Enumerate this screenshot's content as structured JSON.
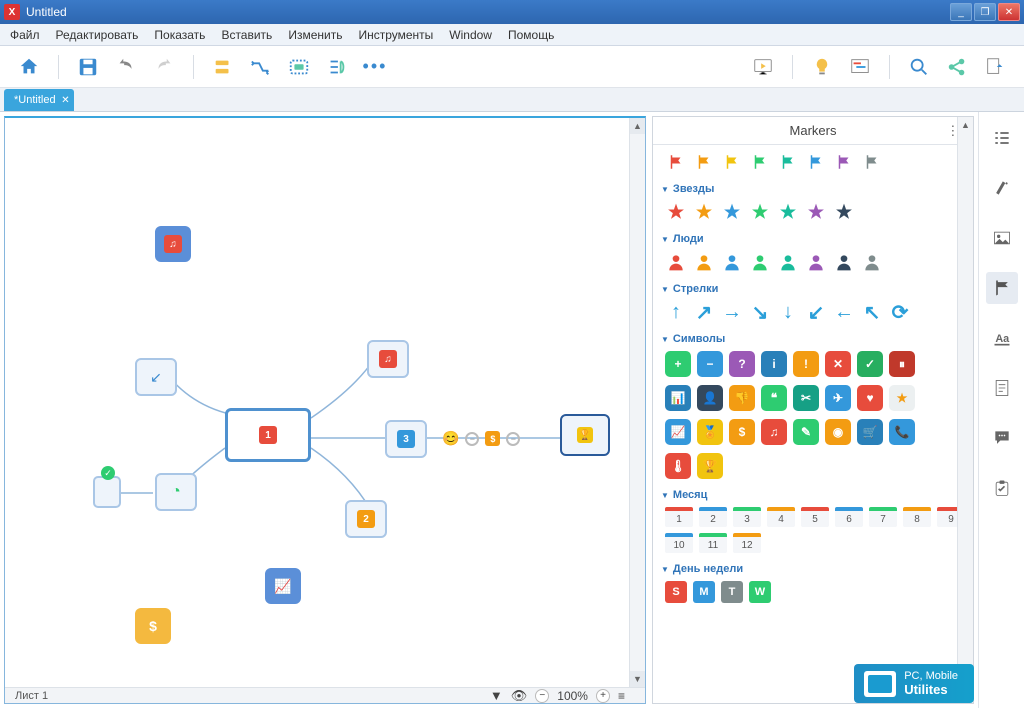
{
  "window": {
    "title": "Untitled"
  },
  "menu": [
    "Файл",
    "Редактировать",
    "Показать",
    "Вставить",
    "Изменить",
    "Инструменты",
    "Window",
    "Помощь"
  ],
  "tab": {
    "label": "*Untitled"
  },
  "statusbar": {
    "sheet": "Лист 1",
    "zoom": "100%"
  },
  "panel": {
    "title": "Markers"
  },
  "groups": {
    "stars": "Звезды",
    "people": "Люди",
    "arrows": "Стрелки",
    "symbols": "Символы",
    "month": "Месяц",
    "weekday": "День недели"
  },
  "colors": {
    "flags": [
      "#e74c3c",
      "#f39c12",
      "#f1c40f",
      "#2ecc71",
      "#1abc9c",
      "#3498db",
      "#9b59b6",
      "#7f8c8d"
    ],
    "stars": [
      "#e74c3c",
      "#f39c12",
      "#3498db",
      "#2ecc71",
      "#1abc9c",
      "#9b59b6",
      "#34495e"
    ],
    "people": [
      "#e74c3c",
      "#f39c12",
      "#3498db",
      "#2ecc71",
      "#1abc9c",
      "#9b59b6",
      "#34495e",
      "#7f8c8d"
    ],
    "arrows": [
      "↑",
      "↗",
      "→",
      "↘",
      "↓",
      "↙",
      "←",
      "↖",
      "⟳"
    ],
    "symbols_set1": [
      {
        "bg": "#2ecc71",
        "t": "+"
      },
      {
        "bg": "#3498db",
        "t": "−"
      },
      {
        "bg": "#9b59b6",
        "t": "?"
      },
      {
        "bg": "#2980b9",
        "t": "i"
      },
      {
        "bg": "#f39c12",
        "t": "!"
      },
      {
        "bg": "#e74c3c",
        "t": "✕"
      },
      {
        "bg": "#27ae60",
        "t": "✓"
      },
      {
        "bg": "#c0392b",
        "t": "⏸"
      }
    ],
    "symbols_set2": [
      {
        "bg": "#2980b9",
        "t": "📊"
      },
      {
        "bg": "#34495e",
        "t": "👤"
      },
      {
        "bg": "#f39c12",
        "t": "👎"
      },
      {
        "bg": "#2ecc71",
        "t": "❝"
      },
      {
        "bg": "#16a085",
        "t": "✂"
      },
      {
        "bg": "#3498db",
        "t": "✈"
      },
      {
        "bg": "#e74c3c",
        "t": "♥"
      },
      {
        "bg": "#ecf0f1",
        "t": "★",
        "fg": "#f39c12"
      }
    ],
    "symbols_set3": [
      {
        "bg": "#3498db",
        "t": "📈"
      },
      {
        "bg": "#f1c40f",
        "t": "🏅"
      },
      {
        "bg": "#f39c12",
        "t": "$"
      },
      {
        "bg": "#e74c3c",
        "t": "♫"
      },
      {
        "bg": "#2ecc71",
        "t": "✎"
      },
      {
        "bg": "#f39c12",
        "t": "◉"
      },
      {
        "bg": "#2980b9",
        "t": "🛒"
      },
      {
        "bg": "#3498db",
        "t": "📞"
      }
    ],
    "symbols_set4": [
      {
        "bg": "#e74c3c",
        "t": "🌡"
      },
      {
        "bg": "#f1c40f",
        "t": "🏆"
      }
    ],
    "months": [
      {
        "n": "1",
        "c": "#e74c3c"
      },
      {
        "n": "2",
        "c": "#3498db"
      },
      {
        "n": "3",
        "c": "#2ecc71"
      },
      {
        "n": "4",
        "c": "#f39c12"
      },
      {
        "n": "5",
        "c": "#e74c3c"
      },
      {
        "n": "6",
        "c": "#3498db"
      },
      {
        "n": "7",
        "c": "#2ecc71"
      },
      {
        "n": "8",
        "c": "#f39c12"
      },
      {
        "n": "9",
        "c": "#e74c3c"
      },
      {
        "n": "10",
        "c": "#3498db"
      },
      {
        "n": "11",
        "c": "#2ecc71"
      },
      {
        "n": "12",
        "c": "#f39c12"
      }
    ],
    "weekdays": [
      {
        "t": "S",
        "c": "#e74c3c"
      },
      {
        "t": "M",
        "c": "#3498db"
      },
      {
        "t": "T",
        "c": "#7f8c8d"
      },
      {
        "t": "W",
        "c": "#2ecc71"
      }
    ]
  },
  "canvas": {
    "central_marker": "1",
    "sub_right_top": "♫",
    "sub_right_mid": "3",
    "sub_right_bot": "2",
    "float_music": "♫",
    "float_arrow": "↙",
    "float_pie": "◔",
    "float_chart": "📈",
    "float_dollar": "$"
  },
  "watermark": {
    "l1": "PC, Mobile",
    "l2": "Utilites"
  }
}
